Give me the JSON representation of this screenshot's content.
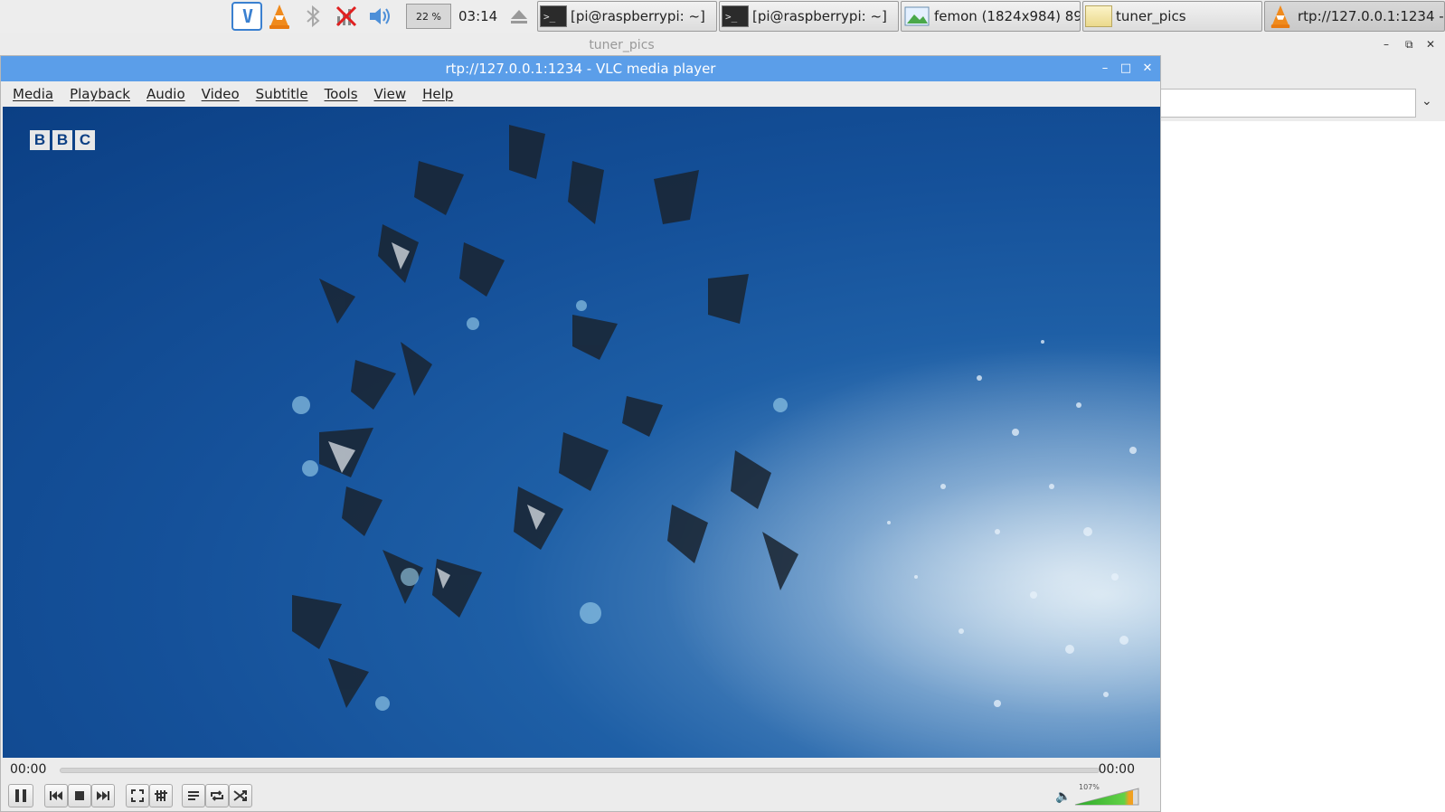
{
  "taskbar": {
    "vnc_icon": "vnc-icon",
    "vlc_icon": "vlc-icon",
    "bluetooth_icon": "bluetooth-icon",
    "network_icon": "network-disconnected-icon",
    "volume_icon": "volume-icon",
    "cpu_usage": "22 %",
    "clock": "03:14",
    "eject_icon": "eject-icon",
    "tasks": [
      {
        "label": "[pi@raspberrypi: ~]",
        "icon": "terminal-icon"
      },
      {
        "label": "[pi@raspberrypi: ~]",
        "icon": "terminal-icon"
      },
      {
        "label": "femon (1824x984) 89...",
        "icon": "image-viewer-icon"
      },
      {
        "label": "tuner_pics",
        "icon": "folder-icon"
      },
      {
        "label": "rtp://127.0.0.1:1234 - ...",
        "icon": "vlc-icon"
      }
    ]
  },
  "background_window": {
    "title": "tuner_pics"
  },
  "vlc": {
    "title": "rtp://127.0.0.1:1234 - VLC media player",
    "menu": [
      "Media",
      "Playback",
      "Audio",
      "Video",
      "Subtitle",
      "Tools",
      "View",
      "Help"
    ],
    "time_elapsed": "00:00",
    "time_total": "00:00",
    "seek_fraction": 0,
    "volume_percent_label": "107%",
    "volume_fraction": 1.0,
    "video_watermark": "BBC",
    "colors": {
      "titlebar": "#5b9ee9",
      "ocean": "#1e5fa6",
      "volume_green": "#46c03c",
      "volume_orange": "#f0a020"
    }
  }
}
